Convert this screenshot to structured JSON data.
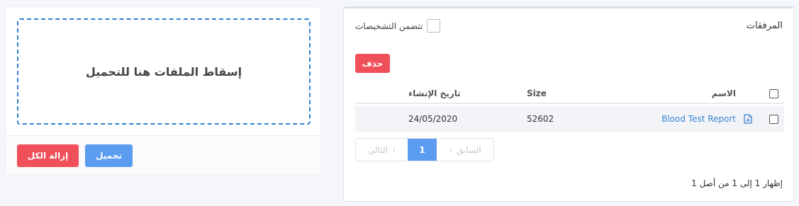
{
  "attachments": {
    "title": "المرفقات",
    "include_diagnoses_label": "تتضمن التشخيصات",
    "delete_label": "حذف",
    "columns": {
      "name": "الاسم",
      "size": "Size",
      "created": "تاريخ الإنشاء"
    },
    "rows": [
      {
        "name": "Blood Test Report",
        "size": "52602",
        "created": "24/05/2020",
        "icon": "pdf-file-icon"
      }
    ],
    "pagination": {
      "prev": "السابق",
      "current": "1",
      "next": "التالي"
    },
    "info": "إظهار 1 إلى 1 من أصل 1"
  },
  "upload": {
    "dropzone_text": "إسقاط الملفات هنا للتحميل",
    "upload_label": "تحميل",
    "remove_all_label": "إزالة الكل"
  },
  "colors": {
    "primary": "#5b9cf0",
    "danger": "#f0505a",
    "link": "#3a86d6",
    "dropzone_border": "#2f7fd6"
  }
}
